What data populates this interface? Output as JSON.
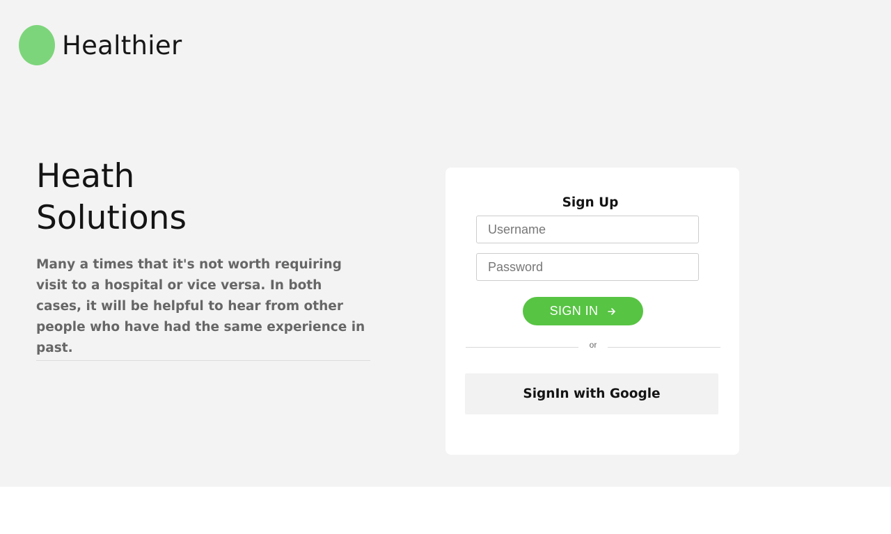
{
  "brand": {
    "name": "Healthier",
    "logo_color": "#7dd57b"
  },
  "hero": {
    "title_line1": "Heath",
    "title_line2": "Solutions",
    "description": "Many a times that it's not worth requiring visit to a hospital or vice versa. In both cases, it will be helpful to hear from other people who have had the same experience in past."
  },
  "form": {
    "title": "Sign Up",
    "username_placeholder": "Username",
    "username_value": "",
    "password_placeholder": "Password",
    "password_value": "",
    "signin_label": "SIGN IN",
    "signin_icon": "arrow-right-icon",
    "divider_text": "or",
    "google_label": "SignIn with Google"
  },
  "colors": {
    "page_background": "#f3f3f3",
    "accent_green": "#57c443",
    "card_background": "#ffffff",
    "google_button_background": "#f2f2f2"
  }
}
